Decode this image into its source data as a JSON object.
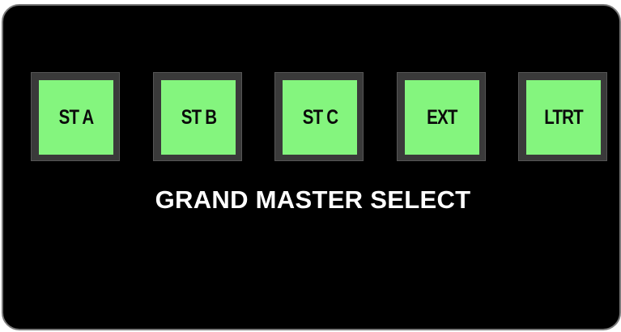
{
  "panel": {
    "title": "GRAND MASTER SELECT",
    "button_color": "#84f57e",
    "buttons": [
      {
        "label": "ST A"
      },
      {
        "label": "ST B"
      },
      {
        "label": "ST C"
      },
      {
        "label": "EXT"
      },
      {
        "label": "LTRT"
      }
    ]
  }
}
